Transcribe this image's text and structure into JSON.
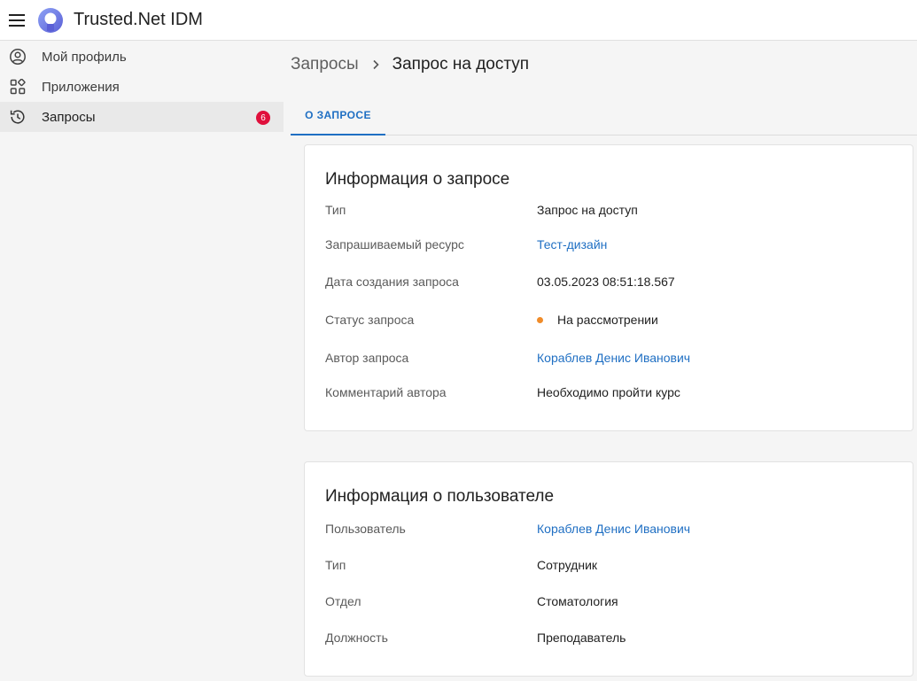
{
  "header": {
    "title": "Trusted.Net IDM",
    "menu_icon": "hamburger-menu-icon",
    "logo_icon": "trusted-net-logo-icon"
  },
  "sidebar": {
    "items": [
      {
        "label": "Мой профиль",
        "icon": "user-circle-icon"
      },
      {
        "label": "Приложения",
        "icon": "apps-grid-icon"
      },
      {
        "label": "Запросы",
        "icon": "history-icon",
        "badge": "6",
        "active": true
      }
    ]
  },
  "breadcrumb": {
    "parent": "Запросы",
    "current": "Запрос на доступ"
  },
  "tabs": [
    {
      "label": "О ЗАПРОСЕ",
      "active": true
    }
  ],
  "request_info": {
    "title": "Информация о запросе",
    "rows": [
      {
        "label": "Тип",
        "value": "Запрос на доступ"
      },
      {
        "label": "Запрашиваемый ресурс",
        "value": "Тест-дизайн"
      },
      {
        "label": "Дата создания запроса",
        "value": "03.05.2023 08:51:18.567"
      },
      {
        "label": "Статус запроса",
        "value": "На рассмотрении"
      },
      {
        "label": "Автор запроса",
        "value": "Кораблев Денис Иванович"
      },
      {
        "label": "Комментарий автора",
        "value": "Необходимо пройти курс"
      }
    ]
  },
  "user_info": {
    "title": "Информация о пользователе",
    "rows": [
      {
        "label": "Пользователь",
        "value": "Кораблев Денис Иванович"
      },
      {
        "label": "Тип",
        "value": "Сотрудник"
      },
      {
        "label": "Отдел",
        "value": "Стоматология"
      },
      {
        "label": "Должность",
        "value": "Преподаватель"
      }
    ]
  },
  "colors": {
    "accent": "#1f6fc3",
    "badge": "#e0103c",
    "status_pending": "#f08c2a"
  }
}
